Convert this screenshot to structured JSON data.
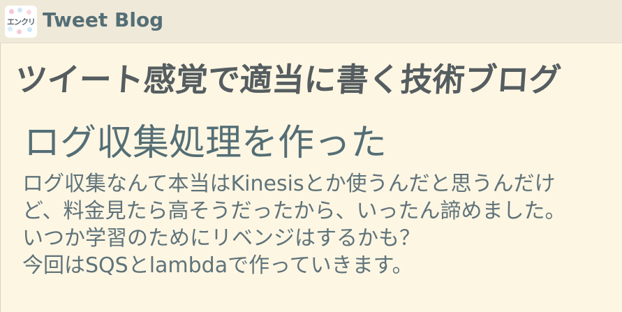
{
  "header": {
    "logo_text": "エンクリ",
    "site_title": "Tweet Blog"
  },
  "tagline": "ツイート感覚で適当に書く技術ブログ",
  "post": {
    "title": "ログ収集処理を作った",
    "paragraphs": [
      "ログ収集なんて本当はKinesisとか使うんだと思うんだけど、料金見たら高そうだったから、いったん諦めました。",
      "いつか学習のためにリベンジはするかも？",
      "今回はSQSとlambdaで作っていきます。"
    ]
  }
}
